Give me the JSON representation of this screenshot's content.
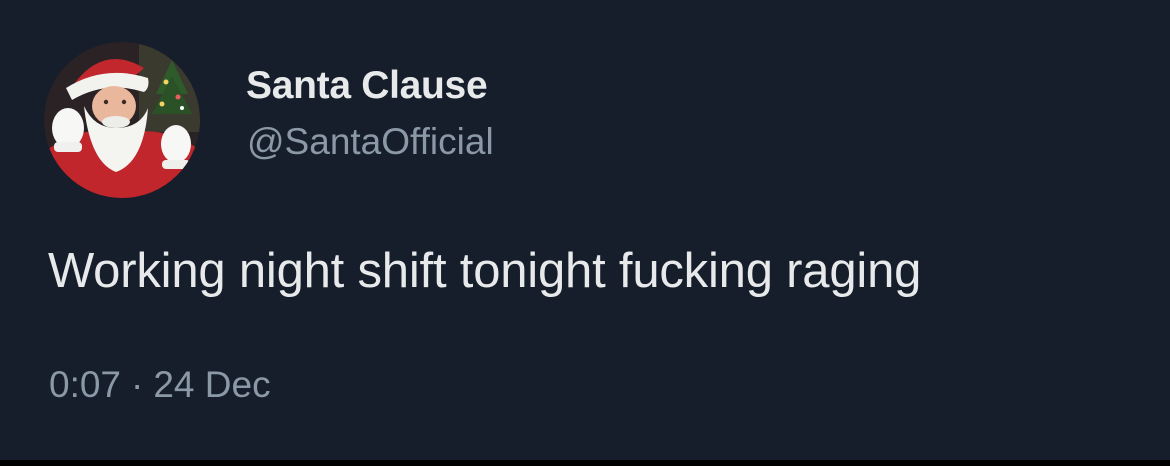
{
  "tweet": {
    "author": {
      "display_name": "Santa Clause",
      "handle": "@SantaOfficial",
      "avatar_icon": "santa-claus-avatar"
    },
    "text": "Working night shift tonight fucking raging",
    "time": "0:07",
    "separator": "·",
    "date": "24 Dec"
  },
  "colors": {
    "background": "#161e2b",
    "primary_text": "#e7e9ea",
    "secondary_text": "#8b98a5"
  }
}
